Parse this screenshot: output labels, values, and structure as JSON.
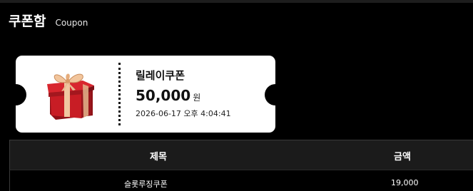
{
  "header": {
    "title": "쿠폰함",
    "subtitle": "Coupon"
  },
  "coupon": {
    "name": "릴레이쿠폰",
    "amount": "50,000",
    "unit": "원",
    "datetime": "2026-06-17 오후 4:04:41",
    "icon": "gift-box-icon"
  },
  "table": {
    "headers": {
      "title": "제목",
      "amount": "금액"
    },
    "rows": [
      {
        "title": "슬롯루징쿠폰",
        "amount": "19,000"
      }
    ]
  },
  "colors": {
    "background": "#000000",
    "ticket": "#ffffff",
    "table_header": "#1b1b1b",
    "gift_red": "#c81d25",
    "ribbon": "#e8b98f"
  }
}
